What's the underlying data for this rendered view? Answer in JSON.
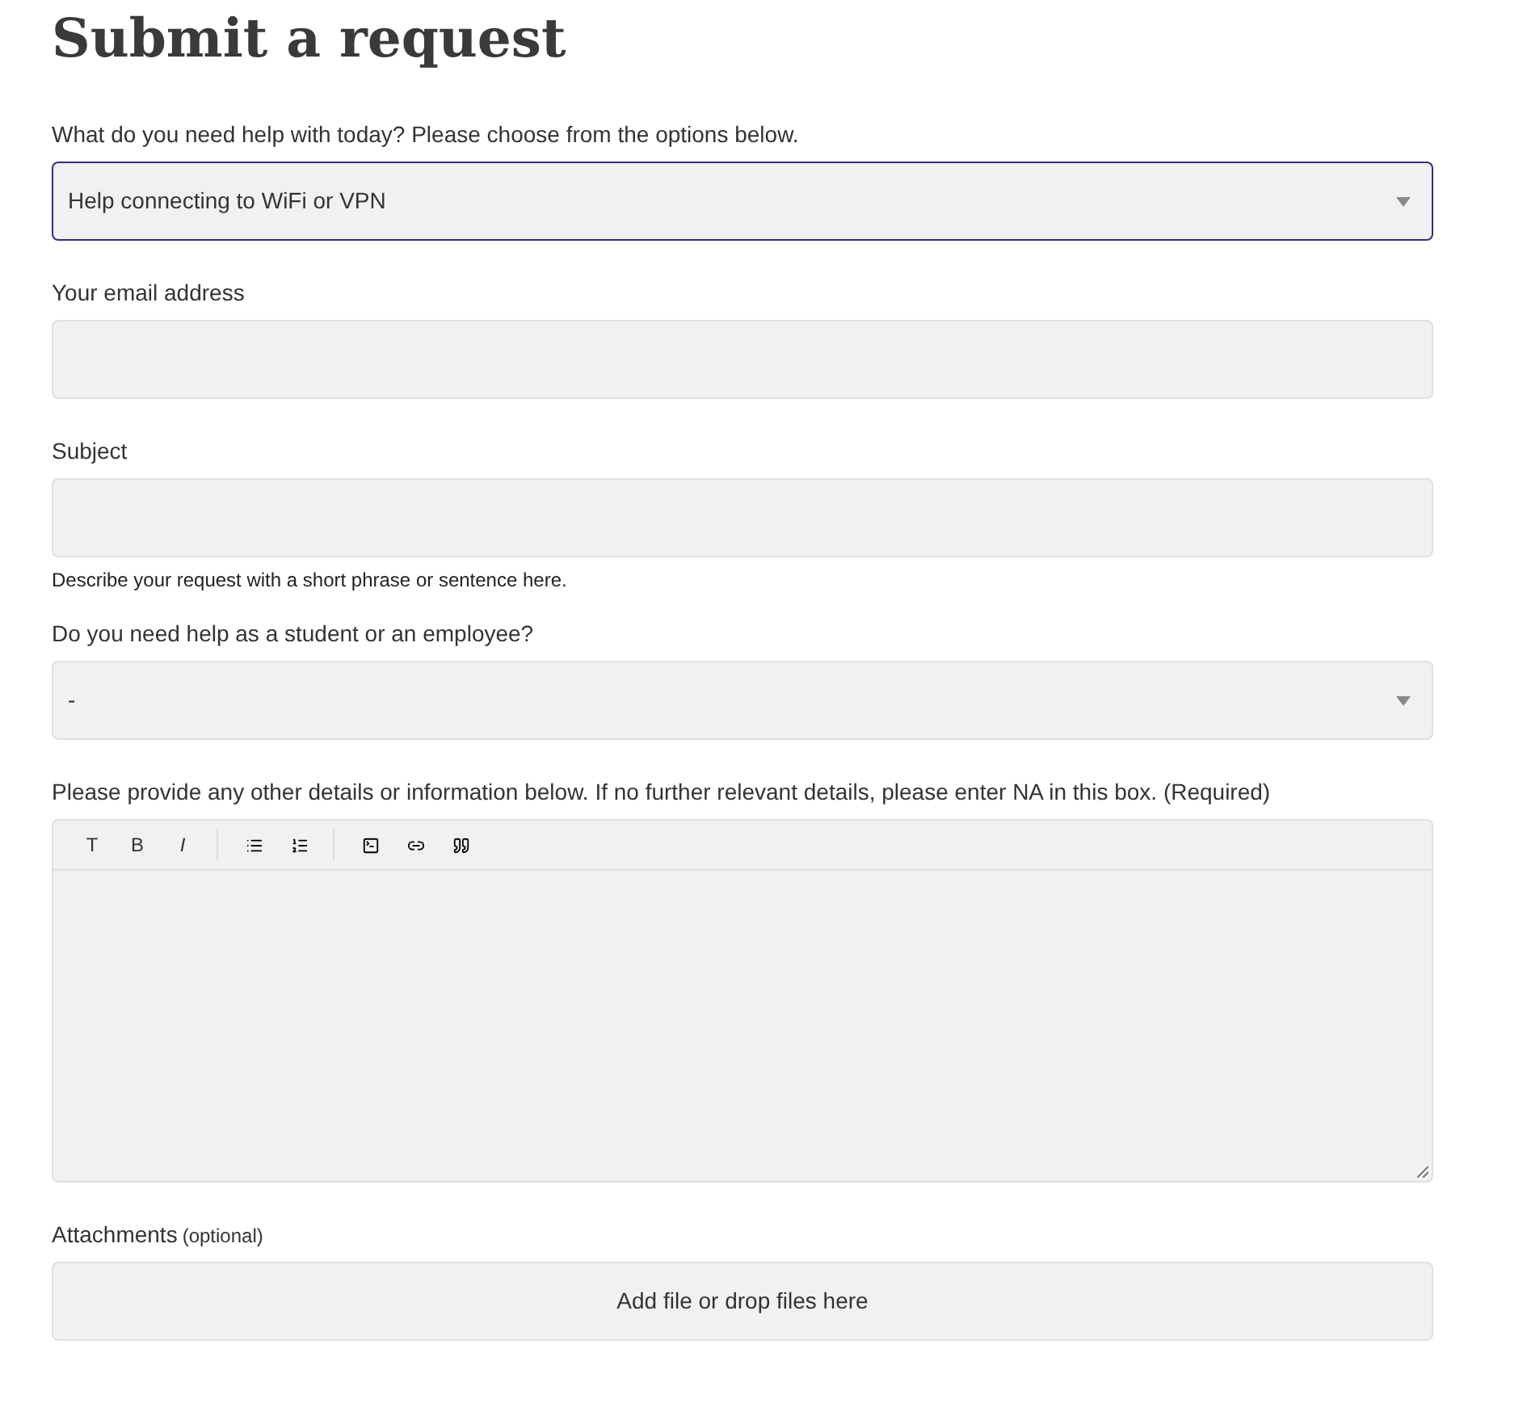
{
  "title": "Submit a request",
  "fields": [
    {
      "kind": "select",
      "label": "What do you need help with today? Please choose from the options below.",
      "value": "Help connecting to WiFi or VPN",
      "focused": true
    },
    {
      "kind": "input",
      "label": "Your email address",
      "focused": false
    },
    {
      "kind": "input",
      "label": "Subject",
      "hint": "Describe your request with a short phrase or sentence here.",
      "focused": false
    },
    {
      "kind": "select",
      "label": "Do you need help as a student or an employee?",
      "value": "-",
      "focused": false
    },
    {
      "kind": "editor",
      "label": "Please provide any other details or information below. If no further relevant details, please enter NA in this box. (Required)",
      "focused": false,
      "toolbar": [
        [
          {
            "kind": "text",
            "text": "T"
          },
          {
            "kind": "text",
            "text": "B"
          },
          {
            "kind": "italic",
            "text": "I"
          }
        ],
        [
          {
            "kind": "bullets"
          },
          {
            "kind": "numbers"
          }
        ],
        [
          {
            "kind": "code"
          },
          {
            "kind": "link"
          },
          {
            "kind": "quote"
          }
        ]
      ]
    },
    {
      "kind": "attachment",
      "label": "Attachments",
      "note": "(optional)",
      "button": "Add file or drop files here"
    }
  ]
}
